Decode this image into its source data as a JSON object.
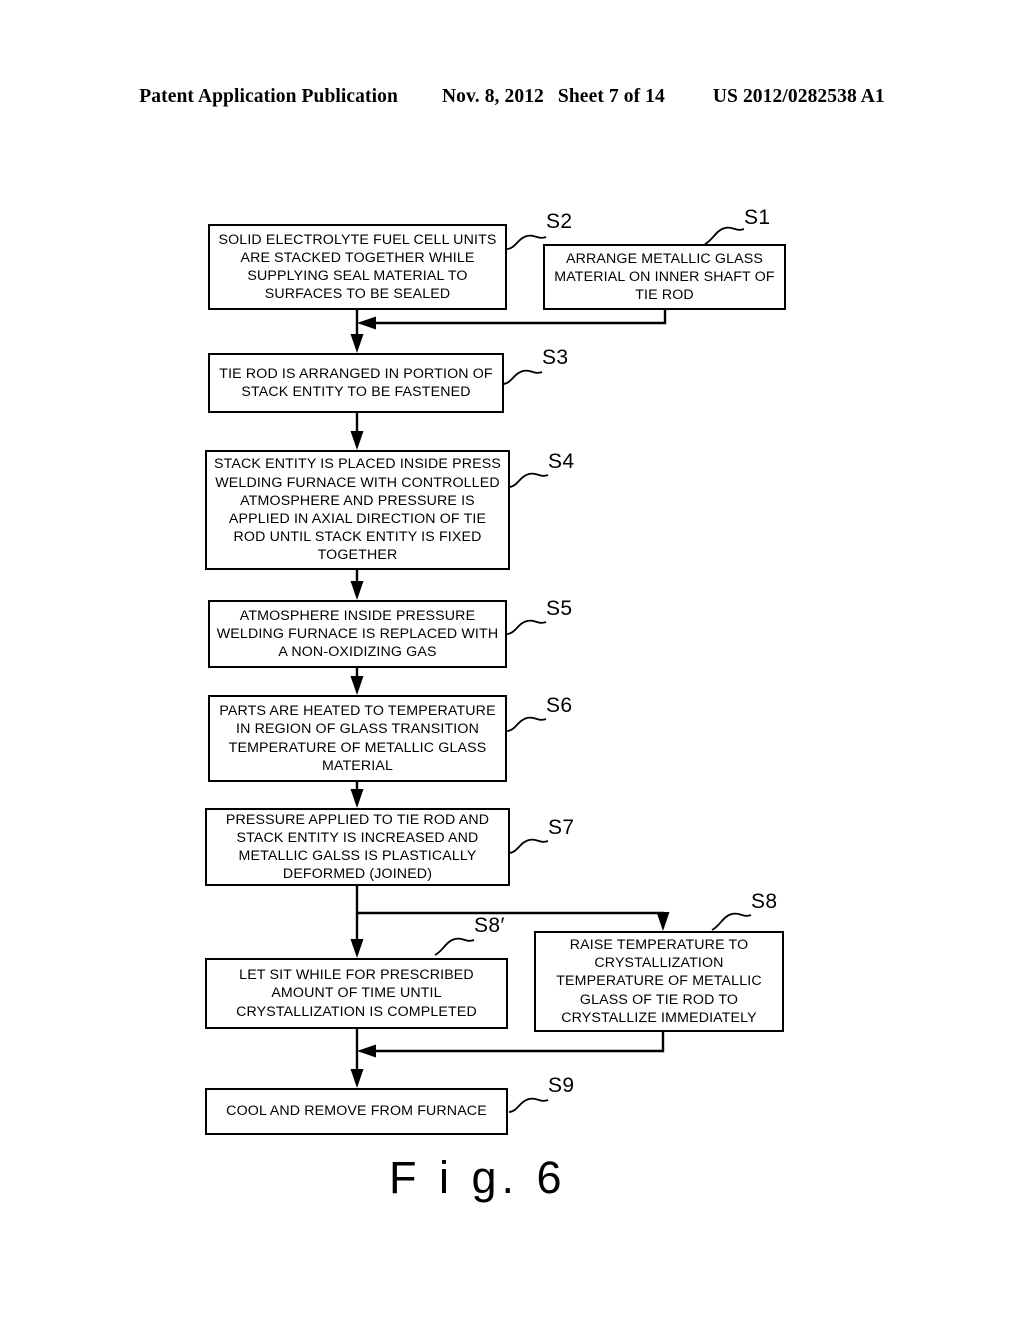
{
  "header": {
    "publication": "Patent Application Publication",
    "date": "Nov. 8, 2012",
    "sheet": "Sheet 7 of 14",
    "number": "US 2012/0282538 A1"
  },
  "figure": {
    "caption": "F i g. 6"
  },
  "flowchart": {
    "steps": [
      {
        "id": "S2",
        "label": "S2",
        "text": "SOLID ELECTROLYTE FUEL CELL UNITS ARE STACKED TOGETHER WHILE SUPPLYING SEAL MATERIAL TO SURFACES TO BE SEALED"
      },
      {
        "id": "S1",
        "label": "S1",
        "text": "ARRANGE METALLIC GLASS MATERIAL ON INNER SHAFT OF TIE ROD"
      },
      {
        "id": "S3",
        "label": "S3",
        "text": "TIE ROD IS ARRANGED IN PORTION OF STACK ENTITY TO BE FASTENED"
      },
      {
        "id": "S4",
        "label": "S4",
        "text": "STACK ENTITY IS PLACED INSIDE PRESS WELDING FURNACE WITH CONTROLLED ATMOSPHERE AND PRESSURE IS APPLIED IN AXIAL DIRECTION OF TIE ROD UNTIL STACK ENTITY IS FIXED TOGETHER"
      },
      {
        "id": "S5",
        "label": "S5",
        "text": "ATMOSPHERE INSIDE PRESSURE WELDING FURNACE IS REPLACED WITH A NON-OXIDIZING GAS"
      },
      {
        "id": "S6",
        "label": "S6",
        "text": "PARTS ARE HEATED TO TEMPERATURE IN REGION OF GLASS TRANSITION TEMPERATURE OF METALLIC GLASS MATERIAL"
      },
      {
        "id": "S7",
        "label": "S7",
        "text": "PRESSURE APPLIED TO TIE ROD AND STACK ENTITY IS INCREASED AND METALLIC GALSS IS PLASTICALLY DEFORMED (JOINED)"
      },
      {
        "id": "S8prime",
        "label": "S8′",
        "text": "LET SIT WHILE FOR PRESCRIBED AMOUNT OF TIME UNTIL CRYSTALLIZATION IS COMPLETED"
      },
      {
        "id": "S8",
        "label": "S8",
        "text": "RAISE TEMPERATURE TO CRYSTALLIZATION TEMPERATURE OF METALLIC GLASS OF TIE ROD TO CRYSTALLIZE IMMEDIATELY"
      },
      {
        "id": "S9",
        "label": "S9",
        "text": "COOL AND REMOVE FROM FURNACE"
      }
    ]
  }
}
